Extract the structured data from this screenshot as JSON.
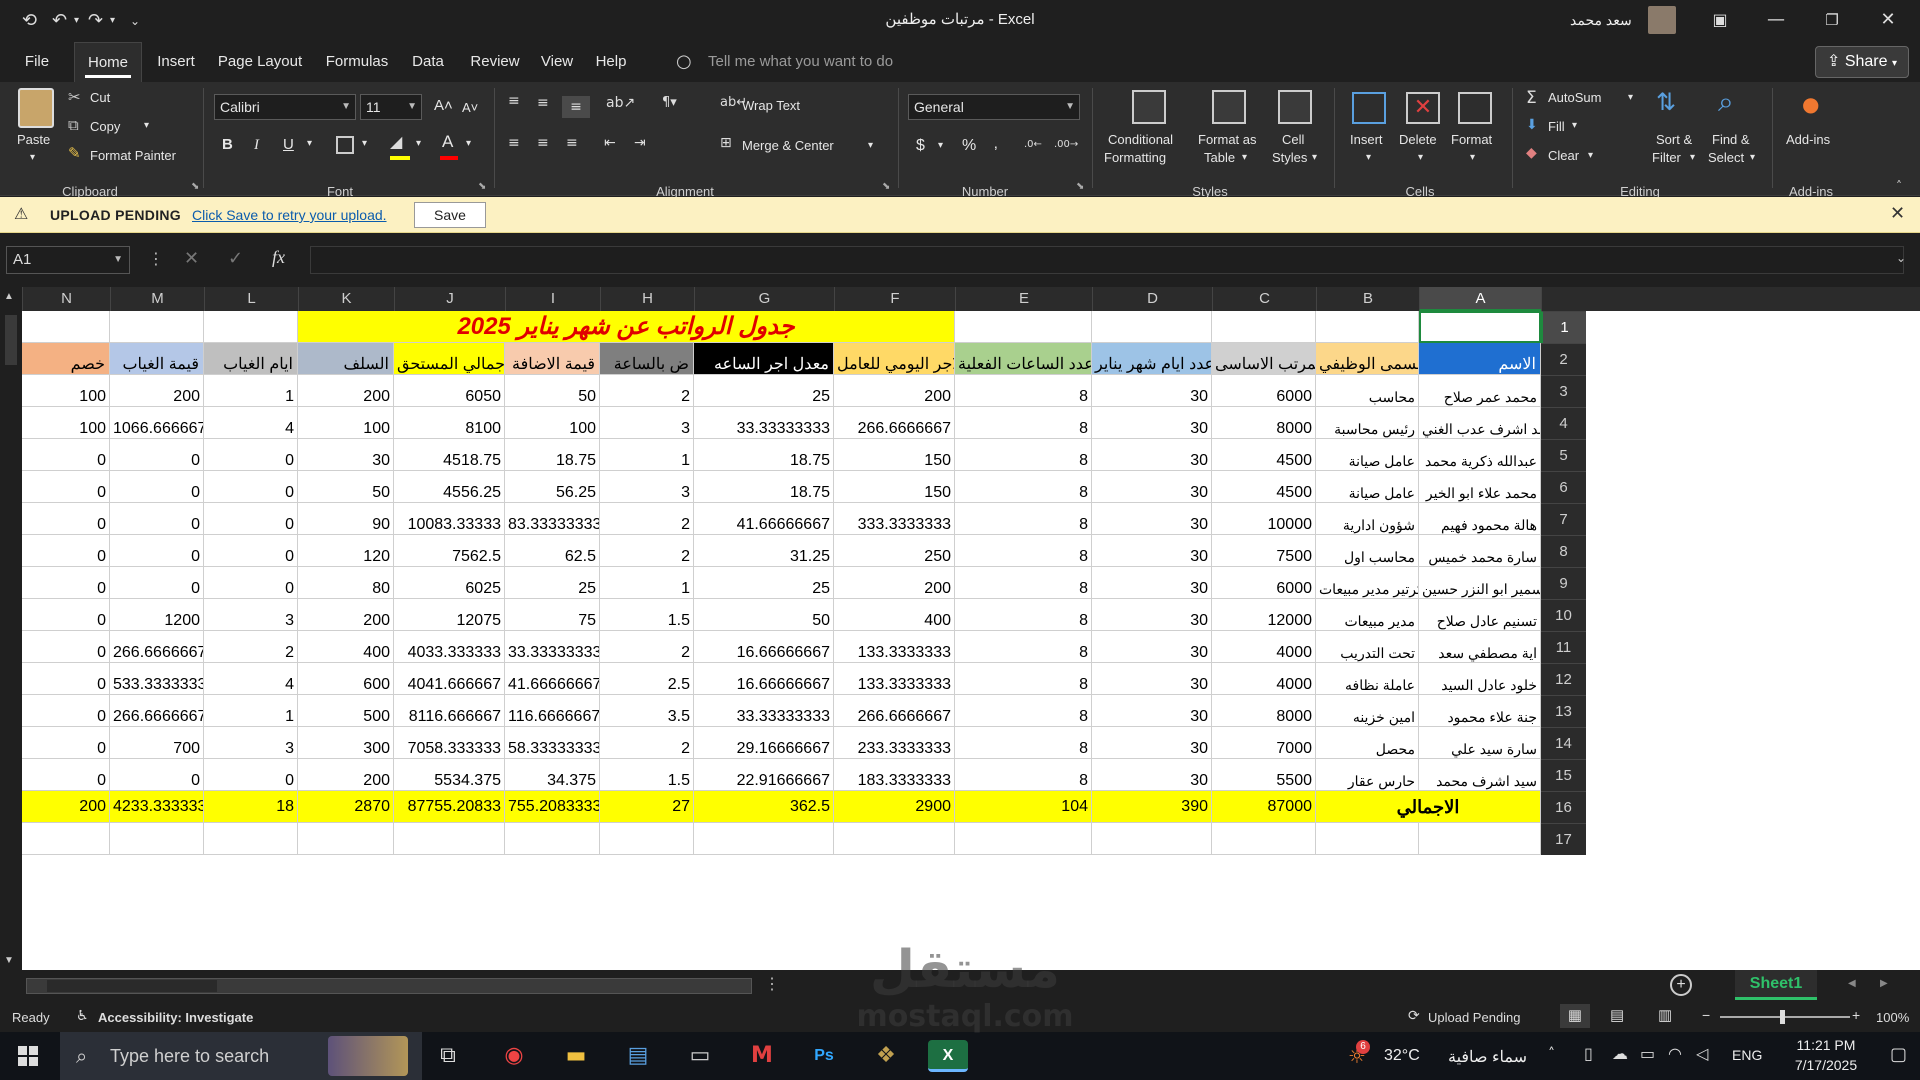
{
  "window": {
    "title": "مرتبات موظفين  -  Excel",
    "user": "سعد محمد",
    "colors": {
      "accent": "#1e8a3e",
      "ribbon_bg": "#2d2d2d"
    }
  },
  "menu": {
    "tabs": [
      "File",
      "Home",
      "Insert",
      "Page Layout",
      "Formulas",
      "Data",
      "Review",
      "View",
      "Help"
    ],
    "tell_me": "Tell me what you want to do",
    "share": "Share"
  },
  "ribbon": {
    "clipboard": {
      "paste": "Paste",
      "cut": "Cut",
      "copy": "Copy",
      "format_painter": "Format Painter",
      "group": "Clipboard"
    },
    "font": {
      "name": "Calibri",
      "size": "11",
      "group": "Font",
      "bold": "B",
      "italic": "I",
      "underline": "U"
    },
    "alignment": {
      "wrap": "Wrap Text",
      "merge": "Merge & Center",
      "group": "Alignment"
    },
    "number": {
      "format": "General",
      "group": "Number",
      "currency": "$",
      "percent": "%",
      "comma": "‚"
    },
    "styles": {
      "conditional": "Conditional",
      "conditional2": "Formatting",
      "format_table": "Format as",
      "format_table2": "Table",
      "cell_styles": "Cell",
      "cell_styles2": "Styles",
      "group": "Styles"
    },
    "cells": {
      "insert": "Insert",
      "delete": "Delete",
      "format": "Format",
      "group": "Cells"
    },
    "editing": {
      "autosum": "AutoSum",
      "fill": "Fill",
      "clear": "Clear",
      "sort": "Sort &",
      "sort2": "Filter",
      "find": "Find &",
      "find2": "Select",
      "group": "Editing"
    },
    "addins": {
      "label": "Add-ins",
      "group": "Add-ins"
    }
  },
  "upload": {
    "title": "UPLOAD PENDING",
    "link": "Click Save to retry your upload.",
    "save": "Save"
  },
  "formula_bar": {
    "name_box": "A1",
    "fx": "fx"
  },
  "columns": [
    {
      "id": "N"
    },
    {
      "id": "M"
    },
    {
      "id": "L"
    },
    {
      "id": "K"
    },
    {
      "id": "J"
    },
    {
      "id": "I"
    },
    {
      "id": "H"
    },
    {
      "id": "G"
    },
    {
      "id": "F"
    },
    {
      "id": "E"
    },
    {
      "id": "D"
    },
    {
      "id": "C"
    },
    {
      "id": "B"
    },
    {
      "id": "A"
    }
  ],
  "sheet": {
    "title": "جدول الرواتب عن شهر يناير 2025",
    "headers": [
      "الاسم",
      "المسمى الوظيفي",
      "المرتب الاساسى",
      "عدد ايام شهر يناير",
      "عدد الساعات الفعلية",
      "الاجر اليومي للعامل",
      "معدل اجر الساعه",
      "ض بالساعة",
      "قيمة الاضافة",
      "اجمالي المستحق",
      "السلف",
      "ايام الغياب",
      "قيمة الغياب",
      "خصم"
    ],
    "rows": [
      [
        "محمد عمر صلاح",
        "محاسب",
        "6000",
        "30",
        "8",
        "200",
        "25",
        "2",
        "50",
        "6050",
        "200",
        "1",
        "200",
        "100"
      ],
      [
        "محمد اشرف عدب الغني",
        "رئيس محاسبة",
        "8000",
        "30",
        "8",
        "266.6666667",
        "33.33333333",
        "3",
        "100",
        "8100",
        "100",
        "4",
        "1066.666667",
        "100"
      ],
      [
        "عبدالله ذكرية محمد",
        "عامل صيانة",
        "4500",
        "30",
        "8",
        "150",
        "18.75",
        "1",
        "18.75",
        "4518.75",
        "30",
        "0",
        "0",
        "0"
      ],
      [
        "محمد علاء ابو الخير",
        "عامل صيانة",
        "4500",
        "30",
        "8",
        "150",
        "18.75",
        "3",
        "56.25",
        "4556.25",
        "50",
        "0",
        "0",
        "0"
      ],
      [
        "هالة محمود فهيم",
        "شؤون ادارية",
        "10000",
        "30",
        "8",
        "333.3333333",
        "41.66666667",
        "2",
        "83.33333333",
        "10083.33333",
        "90",
        "0",
        "0",
        "0"
      ],
      [
        "سارة محمد خميس",
        "محاسب اول",
        "7500",
        "30",
        "8",
        "250",
        "31.25",
        "2",
        "62.5",
        "7562.5",
        "120",
        "0",
        "0",
        "0"
      ],
      [
        "سمير ابو النزر حسين",
        "سكرتير مدير مبيعات",
        "6000",
        "30",
        "8",
        "200",
        "25",
        "1",
        "25",
        "6025",
        "80",
        "0",
        "0",
        "0"
      ],
      [
        "تسنيم عادل صلاح",
        "مدير مبيعات",
        "12000",
        "30",
        "8",
        "400",
        "50",
        "1.5",
        "75",
        "12075",
        "200",
        "3",
        "1200",
        "0"
      ],
      [
        "اية مصطفي سعد",
        "تحت التدريب",
        "4000",
        "30",
        "8",
        "133.3333333",
        "16.66666667",
        "2",
        "33.33333333",
        "4033.333333",
        "400",
        "2",
        "266.6666667",
        "0"
      ],
      [
        "خلود عادل السيد",
        "عاملة نظافه",
        "4000",
        "30",
        "8",
        "133.3333333",
        "16.66666667",
        "2.5",
        "41.66666667",
        "4041.666667",
        "600",
        "4",
        "533.3333333",
        "0"
      ],
      [
        "جنة علاء محمود",
        "امين خزينه",
        "8000",
        "30",
        "8",
        "266.6666667",
        "33.33333333",
        "3.5",
        "116.6666667",
        "8116.666667",
        "500",
        "1",
        "266.6666667",
        "0"
      ],
      [
        "سارة سيد علي",
        "محصل",
        "7000",
        "30",
        "8",
        "233.3333333",
        "29.16666667",
        "2",
        "58.33333333",
        "7058.333333",
        "300",
        "3",
        "700",
        "0"
      ],
      [
        "سيد اشرف محمد",
        "حارس عقار",
        "5500",
        "30",
        "8",
        "183.3333333",
        "22.91666667",
        "1.5",
        "34.375",
        "5534.375",
        "200",
        "0",
        "0",
        "0"
      ]
    ],
    "totals": {
      "label": "الاجمالي",
      "values": [
        "87000",
        "390",
        "104",
        "2900",
        "362.5",
        "27",
        "755.2083333",
        "87755.20833",
        "2870",
        "18",
        "4233.333333",
        "200"
      ]
    },
    "row_numbers": [
      "1",
      "2",
      "3",
      "4",
      "5",
      "6",
      "7",
      "8",
      "9",
      "10",
      "11",
      "12",
      "13",
      "14",
      "15",
      "16",
      "17"
    ],
    "tab": "Sheet1"
  },
  "status": {
    "ready": "Ready",
    "accessibility": "Accessibility: Investigate",
    "upload": "Upload Pending",
    "zoom": "100%"
  },
  "taskbar": {
    "search": "Type here to search",
    "weather_temp": "32°C",
    "weather_text": "سماء صافية",
    "lang": "ENG",
    "time": "11:21 PM",
    "date": "7/17/2025",
    "badge": "6"
  },
  "watermark": {
    "line1": "مستقل",
    "line2": "mostaql.com"
  }
}
